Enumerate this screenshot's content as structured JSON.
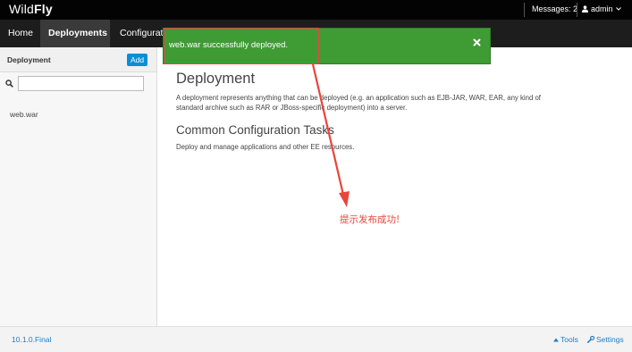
{
  "header": {
    "brand_light": "Wild",
    "brand_bold": "Fly",
    "messages_label": "Messages: 2",
    "user_label": "admin"
  },
  "nav": {
    "items": [
      {
        "label": "Home"
      },
      {
        "label": "Deployments"
      },
      {
        "label": "Configurati"
      }
    ],
    "active": "Deployments"
  },
  "sidebar": {
    "title": "Deployment",
    "add_label": "Add",
    "search_value": "",
    "items": [
      {
        "label": "web.war"
      }
    ]
  },
  "main": {
    "title": "Deployment",
    "description": "A deployment represents anything that can be deployed (e.g. an application such as EJB-JAR, WAR, EAR, any kind of standard archive such as RAR or JBoss-specific deployment) into a server.",
    "tasks_title": "Common Configuration Tasks",
    "tasks_description": "Deploy and manage applications and other EE resources."
  },
  "notification": {
    "message": "web.war successfully deployed.",
    "close_icon": "close-icon",
    "color": "#3f9c35"
  },
  "annotation": {
    "text": "提示发布成功!",
    "color": "#e8453c"
  },
  "footer": {
    "version": "10.1.0.Final",
    "tools_label": "Tools",
    "settings_label": "Settings"
  },
  "colors": {
    "accent": "#0a8fd6",
    "link": "#1e7ec8",
    "topbar": "#030303",
    "navbar": "#1d1d1d"
  }
}
